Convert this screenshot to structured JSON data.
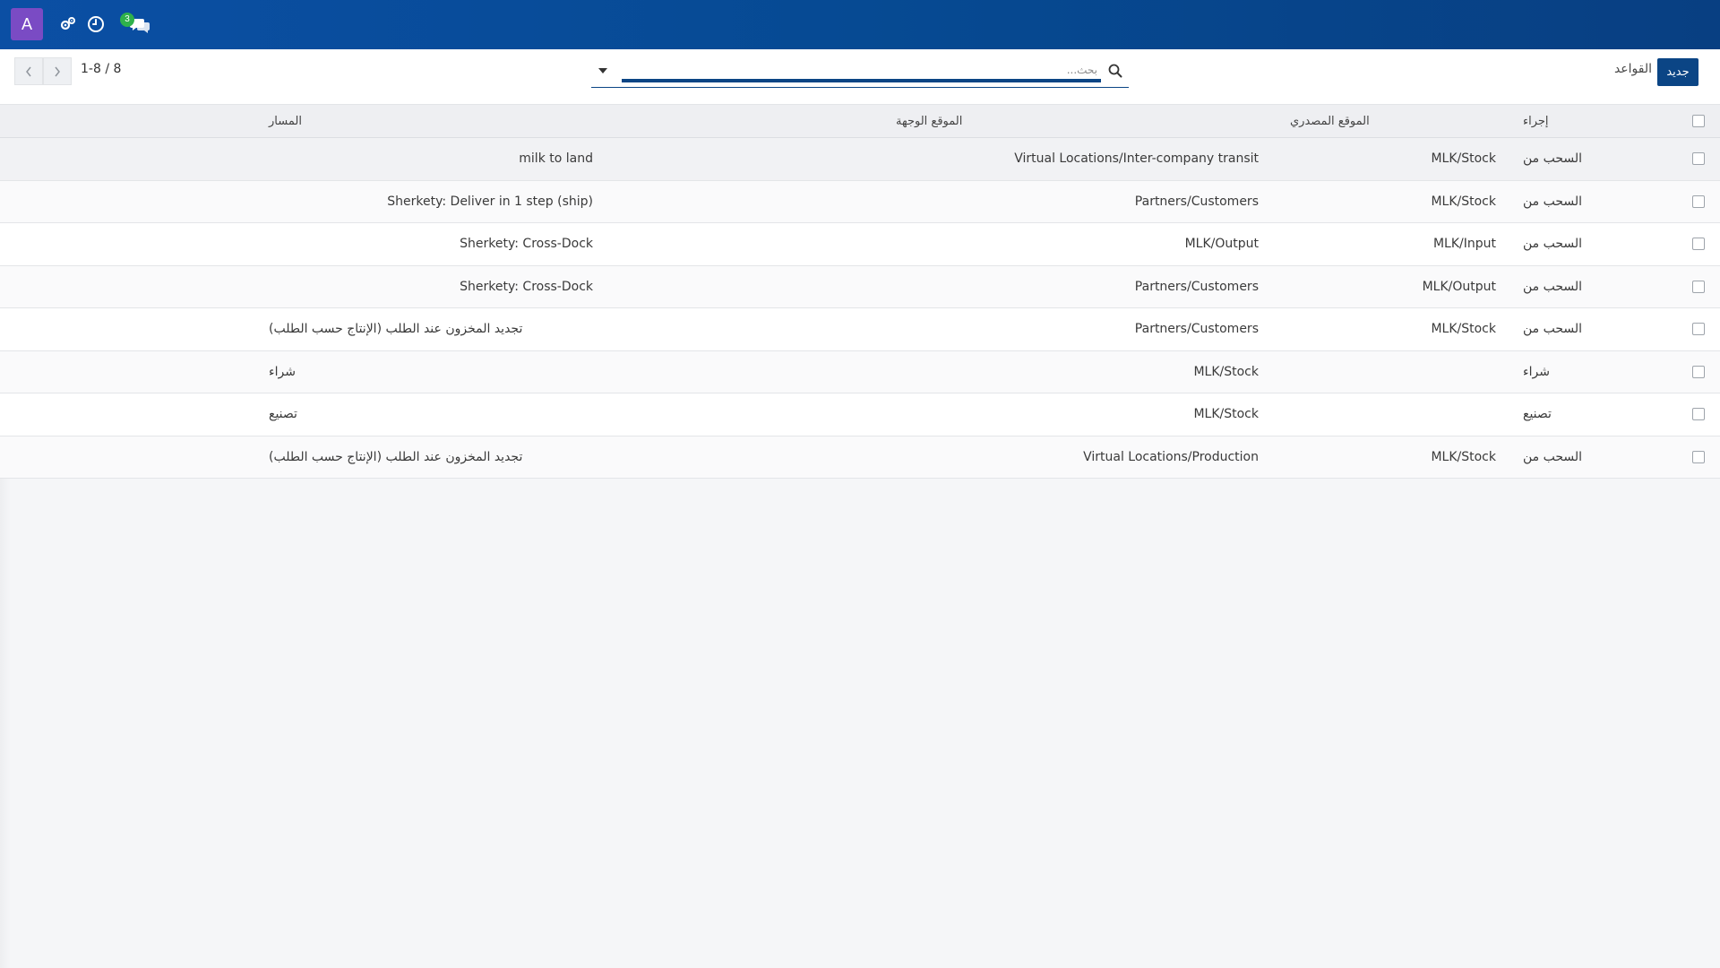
{
  "navbar": {
    "avatar_letter": "A",
    "icons": [
      "settings-gear-icon",
      "clock-icon",
      "chat-icon"
    ],
    "chat_badge": "3",
    "brand_color": "#0b4fa4"
  },
  "control": {
    "new_button_label": "جديد",
    "breadcrumb": "القواعد",
    "search_placeholder": "بحث...",
    "pager_value": "1-8 / 8"
  },
  "table": {
    "columns": {
      "action": "إجراء",
      "source": "الموقع المصدري",
      "destination": "الموقع الوجهة",
      "route": "المسار"
    },
    "rows": [
      {
        "action": "السحب من",
        "source": "MLK/Stock",
        "destination": "Virtual Locations/Inter-company transit",
        "route": "milk to land"
      },
      {
        "action": "السحب من",
        "source": "MLK/Stock",
        "destination": "Partners/Customers",
        "route": "Sherkety: Deliver in 1 step (ship)"
      },
      {
        "action": "السحب من",
        "source": "MLK/Input",
        "destination": "MLK/Output",
        "route": "Sherkety: Cross-Dock"
      },
      {
        "action": "السحب من",
        "source": "MLK/Output",
        "destination": "Partners/Customers",
        "route": "Sherkety: Cross-Dock"
      },
      {
        "action": "السحب من",
        "source": "MLK/Stock",
        "destination": "Partners/Customers",
        "route": "تجديد المخزون عند الطلب (الإنتاج حسب الطلب)"
      },
      {
        "action": "شراء",
        "source": "",
        "destination": "MLK/Stock",
        "route": "شراء"
      },
      {
        "action": "تصنيع",
        "source": "",
        "destination": "MLK/Stock",
        "route": "تصنيع"
      },
      {
        "action": "السحب من",
        "source": "MLK/Stock",
        "destination": "Virtual Locations/Production",
        "route": "تجديد المخزون عند الطلب (الإنتاج حسب الطلب)"
      }
    ]
  }
}
